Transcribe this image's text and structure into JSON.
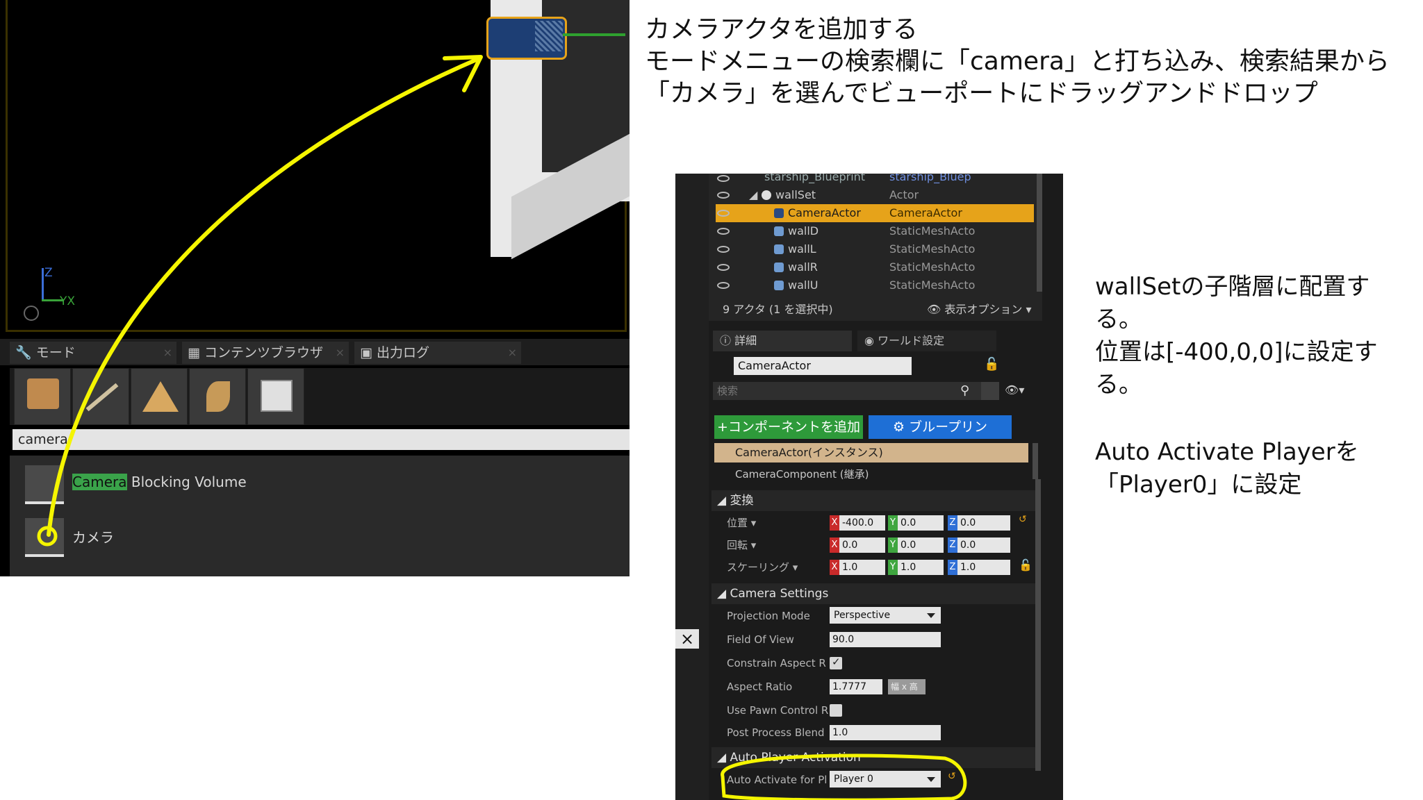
{
  "instruction": {
    "line1": "カメラアクタを追加する",
    "line2": "モードメニューの検索欄に「camera」と打ち込み、検索結果から",
    "line3": "「カメラ」を選んでビューポートにドラッグアンドドロップ"
  },
  "note_hierarchy": {
    "line1": "wallSetの子階層に配置す",
    "line2": "る。",
    "line3": "位置は[-400,0,0]に設定す",
    "line4": "る。"
  },
  "note_player": {
    "line1": "Auto Activate Playerを",
    "line2": "「Player0」に設定"
  },
  "viewport": {
    "axis_z": "Z",
    "axis_yx": "YX"
  },
  "left_tabs": [
    {
      "label": "モード"
    },
    {
      "label": "コンテンツブラウザ"
    },
    {
      "label": "出力ログ"
    }
  ],
  "mode_search": {
    "value": "camera"
  },
  "search_results": [
    {
      "match": "Camera",
      "rest": " Blocking Volume"
    },
    {
      "match": "",
      "rest": "カメラ"
    }
  ],
  "outliner": {
    "rows": [
      {
        "name": "starship_Blueprint",
        "type": "starship_Bluep"
      },
      {
        "name": "wallSet",
        "type": "Actor"
      },
      {
        "name": "CameraActor",
        "type": "CameraActor",
        "selected": true
      },
      {
        "name": "wallD",
        "type": "StaticMeshActo"
      },
      {
        "name": "wallL",
        "type": "StaticMeshActo"
      },
      {
        "name": "wallR",
        "type": "StaticMeshActo"
      },
      {
        "name": "wallU",
        "type": "StaticMeshActo"
      }
    ],
    "status": "9 アクタ (1 を選択中)",
    "view_options": "表示オプション"
  },
  "details": {
    "tab_details": "詳細",
    "tab_world": "ワールド設定",
    "actor_name": "CameraActor",
    "search_placeholder": "検索",
    "add_component": "+コンポーネントを追加",
    "blueprint": "ブループリン",
    "instance_label": "CameraActor(インスタンス)",
    "component_label": "CameraComponent (継承)",
    "transform_header": "変換",
    "location_label": "位置",
    "rotation_label": "回転",
    "scale_label": "スケーリング",
    "location": {
      "x": "-400.0",
      "y": "0.0",
      "z": "0.0"
    },
    "rotation": {
      "x": "0.0",
      "y": "0.0",
      "z": "0.0"
    },
    "scale": {
      "x": "1.0",
      "y": "1.0",
      "z": "1.0"
    },
    "camera_settings_header": "Camera Settings",
    "projection_mode_label": "Projection Mode",
    "projection_mode_value": "Perspective",
    "fov_label": "Field Of View",
    "fov_value": "90.0",
    "constrain_label": "Constrain Aspect R",
    "aspect_label": "Aspect Ratio",
    "aspect_value": "1.7777",
    "aspect_preset": "幅 x 高",
    "use_pawn_label": "Use Pawn Control R",
    "post_process_label": "Post Process Blend",
    "post_process_value": "1.0",
    "auto_player_header": "Auto Player Activation",
    "auto_activate_label": "Auto Activate for Pl",
    "auto_activate_value": "Player 0"
  },
  "colors": {
    "annotation_yellow": "#f5f500",
    "selection_orange": "#e6a31a",
    "instance_row": "#d2b48c",
    "add_component_green": "#2e9a3a",
    "blueprint_blue": "#1e6fd6"
  }
}
